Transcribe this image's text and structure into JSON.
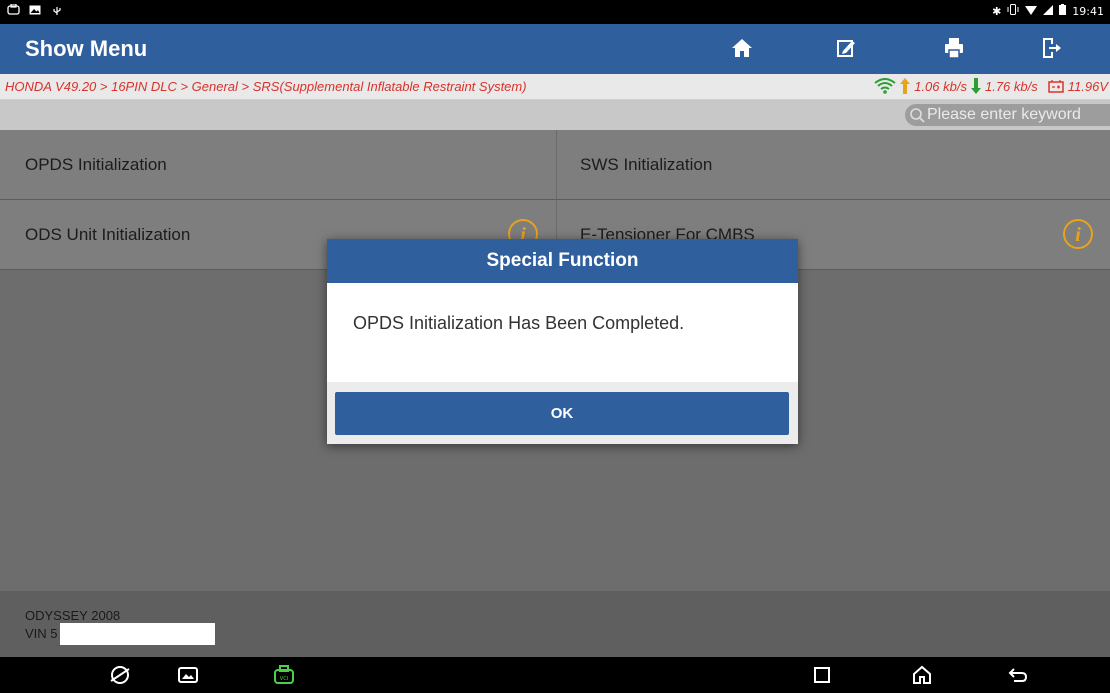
{
  "statusbar": {
    "time": "19:41",
    "left_icons": [
      "vci-icon",
      "image-icon",
      "usb-icon"
    ],
    "right_icons": [
      "bluetooth-icon",
      "vibrate-icon",
      "wifi-icon",
      "signal-icon",
      "battery-icon"
    ]
  },
  "header": {
    "title": "Show Menu",
    "buttons": [
      "home-icon",
      "edit-icon",
      "print-icon",
      "exit-icon"
    ]
  },
  "breadcrumb": "HONDA V49.20 > 16PIN DLC > General > SRS(Supplemental Inflatable Restraint System)",
  "network": {
    "upload": "1.06 kb/s",
    "download": "1.76 kb/s",
    "voltage": "11.96V"
  },
  "search": {
    "placeholder": "Please enter keyword"
  },
  "menu_items": [
    {
      "label": "OPDS Initialization",
      "info": false
    },
    {
      "label": "SWS Initialization",
      "info": false
    },
    {
      "label": "ODS Unit Initialization",
      "info": true
    },
    {
      "label": "E-Tensioner For CMBS",
      "info": true
    }
  ],
  "vehicle": {
    "model": "ODYSSEY 2008",
    "vin": "VIN 5"
  },
  "dialog": {
    "title": "Special Function",
    "message": "OPDS Initialization Has Been Completed.",
    "ok_label": "OK"
  },
  "colors": {
    "header_blue": "#2f5f9c",
    "breadcrumb_red": "#d9322b",
    "upload_green": "#2e9e34",
    "info_orange": "#e8a21c"
  }
}
